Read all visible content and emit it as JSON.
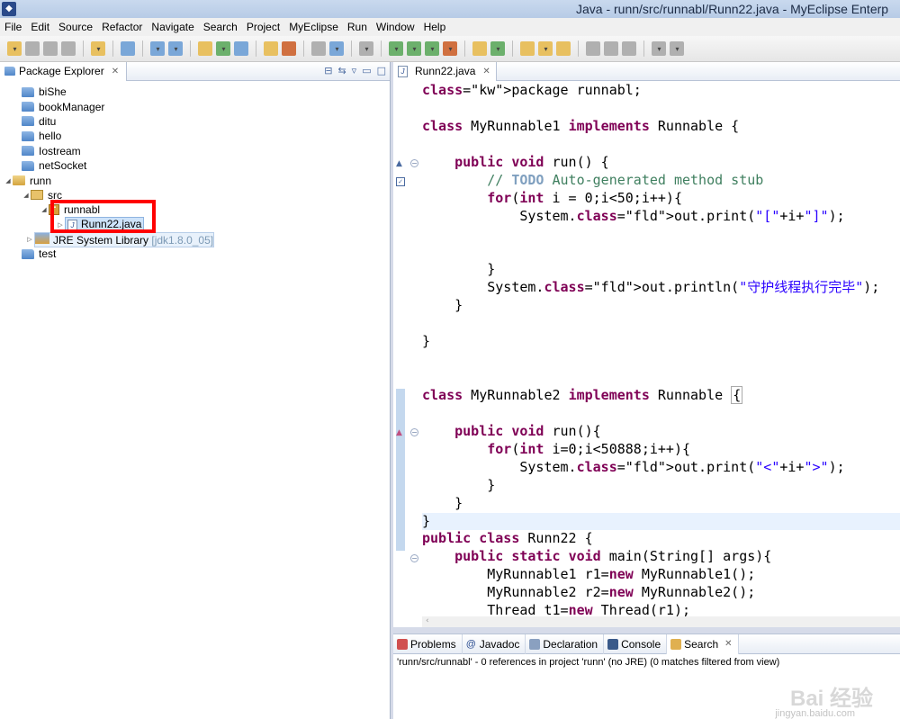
{
  "window": {
    "title": "Java - runn/src/runnabl/Runn22.java - MyEclipse Enterp"
  },
  "menu": [
    "File",
    "Edit",
    "Source",
    "Refactor",
    "Navigate",
    "Search",
    "Project",
    "MyEclipse",
    "Run",
    "Window",
    "Help"
  ],
  "package_explorer": {
    "tab_label": "Package Explorer",
    "tree": [
      {
        "label": "biShe",
        "type": "project"
      },
      {
        "label": "bookManager",
        "type": "project"
      },
      {
        "label": "ditu",
        "type": "project"
      },
      {
        "label": "hello",
        "type": "project"
      },
      {
        "label": "Iostream",
        "type": "project"
      },
      {
        "label": "netSocket",
        "type": "project"
      },
      {
        "label": "runn",
        "type": "project-open"
      },
      {
        "label": "src",
        "type": "source-folder"
      },
      {
        "label": "runnabl",
        "type": "package"
      },
      {
        "label": "Runn22.java",
        "type": "java-file"
      },
      {
        "label": "JRE System Library",
        "suffix": "[jdk1.8.0_05]",
        "type": "library"
      },
      {
        "label": "test",
        "type": "project"
      }
    ]
  },
  "editor": {
    "tab_label": "Runn22.java",
    "lines": [
      "package runnabl;",
      "",
      "class MyRunnable1 implements Runnable {",
      "",
      "    public void run() {",
      "        // TODO Auto-generated method stub",
      "        for(int i = 0;i<50;i++){",
      "            System.out.print(\"[\"+i+\"]\");",
      "",
      "",
      "        }",
      "        System.out.println(\"守护线程执行完毕\");",
      "    }",
      "",
      "}",
      "",
      "",
      "class MyRunnable2 implements Runnable {",
      "",
      "    public void run(){",
      "        for(int i=0;i<50888;i++){",
      "            System.out.print(\"<\"+i+\">\");",
      "        }",
      "    }",
      "}",
      "public class Runn22 {",
      "    public static void main(String[] args){",
      "        MyRunnable1 r1=new MyRunnable1();",
      "        MyRunnable2 r2=new MyRunnable2();",
      "        Thread t1=new Thread(r1);"
    ]
  },
  "bottom_panel": {
    "tabs": [
      "Problems",
      "Javadoc",
      "Declaration",
      "Console",
      "Search"
    ],
    "status": "'runn/src/runnabl' - 0 references in project 'runn' (no JRE) (0 matches filtered from view)"
  },
  "watermark": {
    "brand": "Bai 经验",
    "url": "jingyan.baidu.com"
  },
  "colors": {
    "keyword": "#7f0055",
    "string": "#2a00ff",
    "comment": "#3f7f5f",
    "highlight_box": "#ff0000"
  }
}
